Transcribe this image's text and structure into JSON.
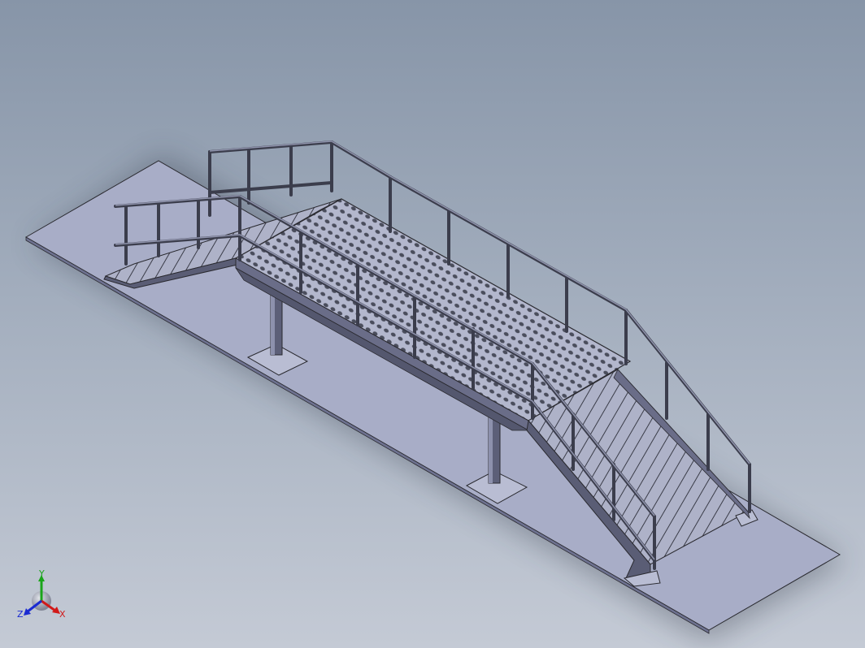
{
  "viewport": {
    "background_top": "#8795a8",
    "background_bottom": "#c4cad5",
    "model_color": "#a9adc6",
    "edge_color": "#2a2a30"
  },
  "triad": {
    "x_label": "X",
    "y_label": "Y",
    "z_label": "Z",
    "x_color": "#d11a1a",
    "y_color": "#1aa51a",
    "z_color": "#1a2ad1"
  }
}
